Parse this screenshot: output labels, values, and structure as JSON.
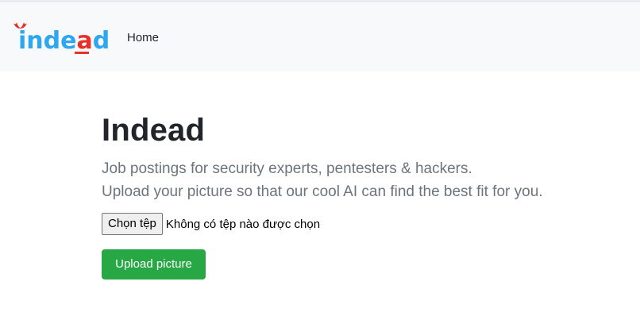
{
  "navbar": {
    "logo_text": "indead",
    "home_label": "Home"
  },
  "main": {
    "title": "Indead",
    "lead_line1": "Job postings for security experts, pentesters & hackers.",
    "lead_line2": "Upload your picture so that our cool AI can find the best fit for you.",
    "file_button_label": "Chọn tệp",
    "file_status": "Không có tệp nào được chọn",
    "upload_button_label": "Upload picture"
  },
  "colors": {
    "navbar_bg": "#f8f9fa",
    "logo_blue": "#2fa6f0",
    "logo_red": "#e8302a",
    "button_green": "#28a745",
    "lead_gray": "#6c757d"
  },
  "icons": {
    "logo_mark": "devil-horns-icon"
  }
}
